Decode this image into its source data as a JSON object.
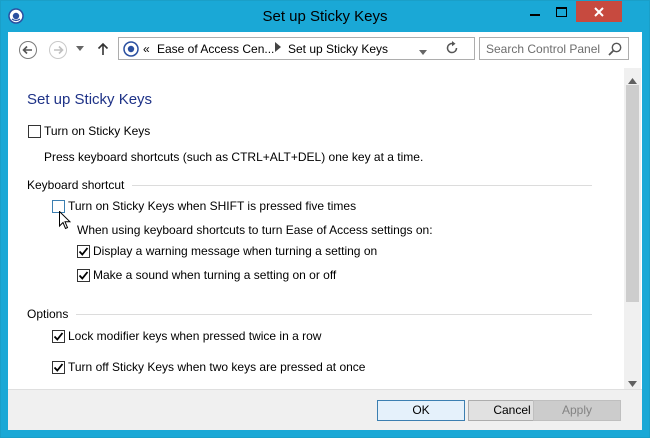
{
  "window": {
    "title": "Set up Sticky Keys",
    "title_bar_color": "#1aa8d6",
    "close_button_color": "#c74a3f"
  },
  "navigation": {
    "back_icon": "back-arrow-icon",
    "forward_icon": "forward-arrow-icon",
    "up_icon": "up-arrow-icon",
    "address": {
      "overflow": "«",
      "crumbs": [
        "Ease of Access Cen...",
        "Set up Sticky Keys"
      ]
    },
    "search": {
      "placeholder": "Search Control Panel"
    }
  },
  "page": {
    "heading": "Set up Sticky Keys",
    "heading_color": "#1e3287",
    "turn_on": {
      "label": "Turn on Sticky Keys",
      "checked": false,
      "description": "Press keyboard shortcuts (such as CTRL+ALT+DEL) one key at a time."
    },
    "keyboard_shortcut": {
      "section_label": "Keyboard shortcut",
      "shift_five_times": {
        "label": "Turn on Sticky Keys when SHIFT is pressed five times",
        "checked": false
      },
      "sub_heading": "When using keyboard shortcuts to turn Ease of Access settings on:",
      "warning_message": {
        "label": "Display a warning message when turning a setting on",
        "checked": true
      },
      "make_sound": {
        "label": "Make a sound when turning a setting on or off",
        "checked": true
      }
    },
    "options": {
      "section_label": "Options",
      "lock_modifier": {
        "label": "Lock modifier keys when pressed twice in a row",
        "checked": true
      },
      "turn_off_two_keys": {
        "label": "Turn off Sticky Keys when two keys are pressed at once",
        "checked": true
      }
    }
  },
  "footer": {
    "ok": "OK",
    "cancel": "Cancel",
    "apply": "Apply"
  }
}
